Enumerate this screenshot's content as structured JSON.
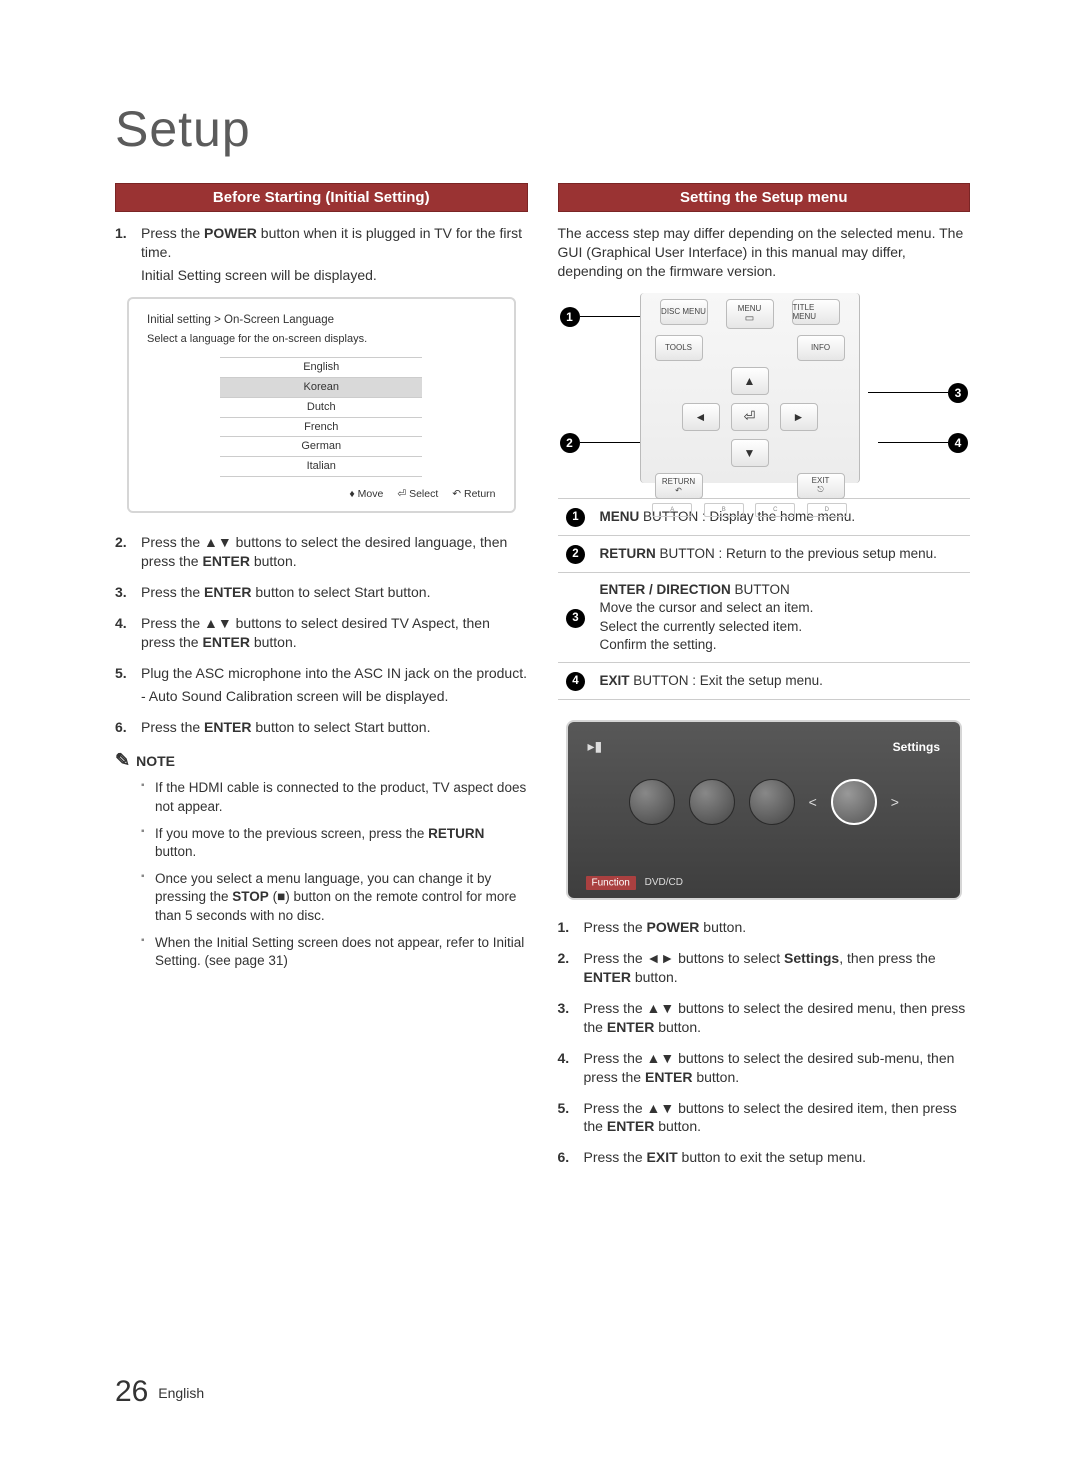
{
  "page_title": "Setup",
  "footer": {
    "page_number": "26",
    "language": "English"
  },
  "left": {
    "header": "Before Starting (Initial Setting)",
    "steps": [
      {
        "n": "1.",
        "pre": "Press the ",
        "b": "POWER",
        "post": " button when it is plugged in TV for the first time.",
        "sub": "Initial Setting screen will be displayed."
      },
      {
        "n": "2.",
        "pre": "Press the ▲▼ buttons to select the desired language, then press the ",
        "b": "ENTER",
        "post": " button."
      },
      {
        "n": "3.",
        "pre": "Press the ",
        "b": "ENTER",
        "post": " button to select Start button."
      },
      {
        "n": "4.",
        "pre": "Press the ▲▼ buttons to select desired TV Aspect, then press the ",
        "b": "ENTER",
        "post": " button."
      },
      {
        "n": "5.",
        "pre": "Plug the ASC microphone into the ASC IN jack on the product.",
        "b": "",
        "post": "",
        "sub": "- Auto Sound Calibration screen will be displayed."
      },
      {
        "n": "6.",
        "pre": "Press the ",
        "b": "ENTER",
        "post": " button to select Start button."
      }
    ],
    "screen": {
      "breadcrumb": "Initial setting > On-Screen Language",
      "instruction": "Select a language for the on-screen displays.",
      "languages": [
        "English",
        "Korean",
        "Dutch",
        "French",
        "German",
        "Italian"
      ],
      "selected": "Korean",
      "footer_move": "♦ Move",
      "footer_select": "⏎ Select",
      "footer_return": "↶ Return"
    },
    "note_label": "NOTE",
    "notes": [
      "If the HDMI cable is connected to the product, TV aspect does not appear.",
      {
        "pre": "If you move to the previous screen, press the ",
        "b": "RETURN",
        "post": " button."
      },
      {
        "pre": "Once you select a menu language, you can change it by pressing the ",
        "b": "STOP",
        "post": " (■) button on the remote control for more than 5 seconds with no disc."
      },
      "When the Initial Setting screen does not appear, refer to Initial Setting. (see page 31)"
    ]
  },
  "right": {
    "header": "Setting the Setup menu",
    "intro": "The access step may differ depending on the selected menu. The GUI (Graphical User Interface) in this manual may differ, depending on the firmware version.",
    "remote_labels": {
      "disc_menu": "DISC MENU",
      "menu": "MENU",
      "title_menu": "TITLE MENU",
      "tools": "TOOLS",
      "info": "INFO",
      "return": "RETURN",
      "exit": "EXIT"
    },
    "callouts": [
      "1",
      "2",
      "3",
      "4"
    ],
    "desc_table": [
      {
        "n": "1",
        "b": "MENU",
        "t1": " BUTTON : Display the home menu."
      },
      {
        "n": "2",
        "b": "RETURN",
        "t1": " BUTTON : Return to the previous setup menu."
      },
      {
        "n": "3",
        "b": "ENTER / DIRECTION",
        "t1": " BUTTON",
        "lines": [
          "Move the cursor and select an item.",
          "Select the currently selected item.",
          "Confirm the setting."
        ]
      },
      {
        "n": "4",
        "b": "EXIT",
        "t1": " BUTTON : Exit the setup menu."
      }
    ],
    "tv": {
      "settings_label": "Settings",
      "func_tag": "Function",
      "func_val": "DVD/CD"
    },
    "steps": [
      {
        "n": "1.",
        "pre": "Press the ",
        "b": "POWER",
        "post": " button."
      },
      {
        "n": "2.",
        "pre": "Press the ◄► buttons to select ",
        "b": "Settings",
        "post": ", then press the ",
        "b2": "ENTER",
        "post2": " button."
      },
      {
        "n": "3.",
        "pre": "Press the ▲▼ buttons to select the desired menu, then press the ",
        "b": "ENTER",
        "post": " button."
      },
      {
        "n": "4.",
        "pre": "Press the ▲▼ buttons to select the desired sub-menu, then press the ",
        "b": "ENTER",
        "post": " button."
      },
      {
        "n": "5.",
        "pre": "Press the ▲▼ buttons to select the desired item, then press the ",
        "b": "ENTER",
        "post": " button."
      },
      {
        "n": "6.",
        "pre": "Press the ",
        "b": "EXIT",
        "post": " button to exit the setup menu."
      }
    ]
  }
}
